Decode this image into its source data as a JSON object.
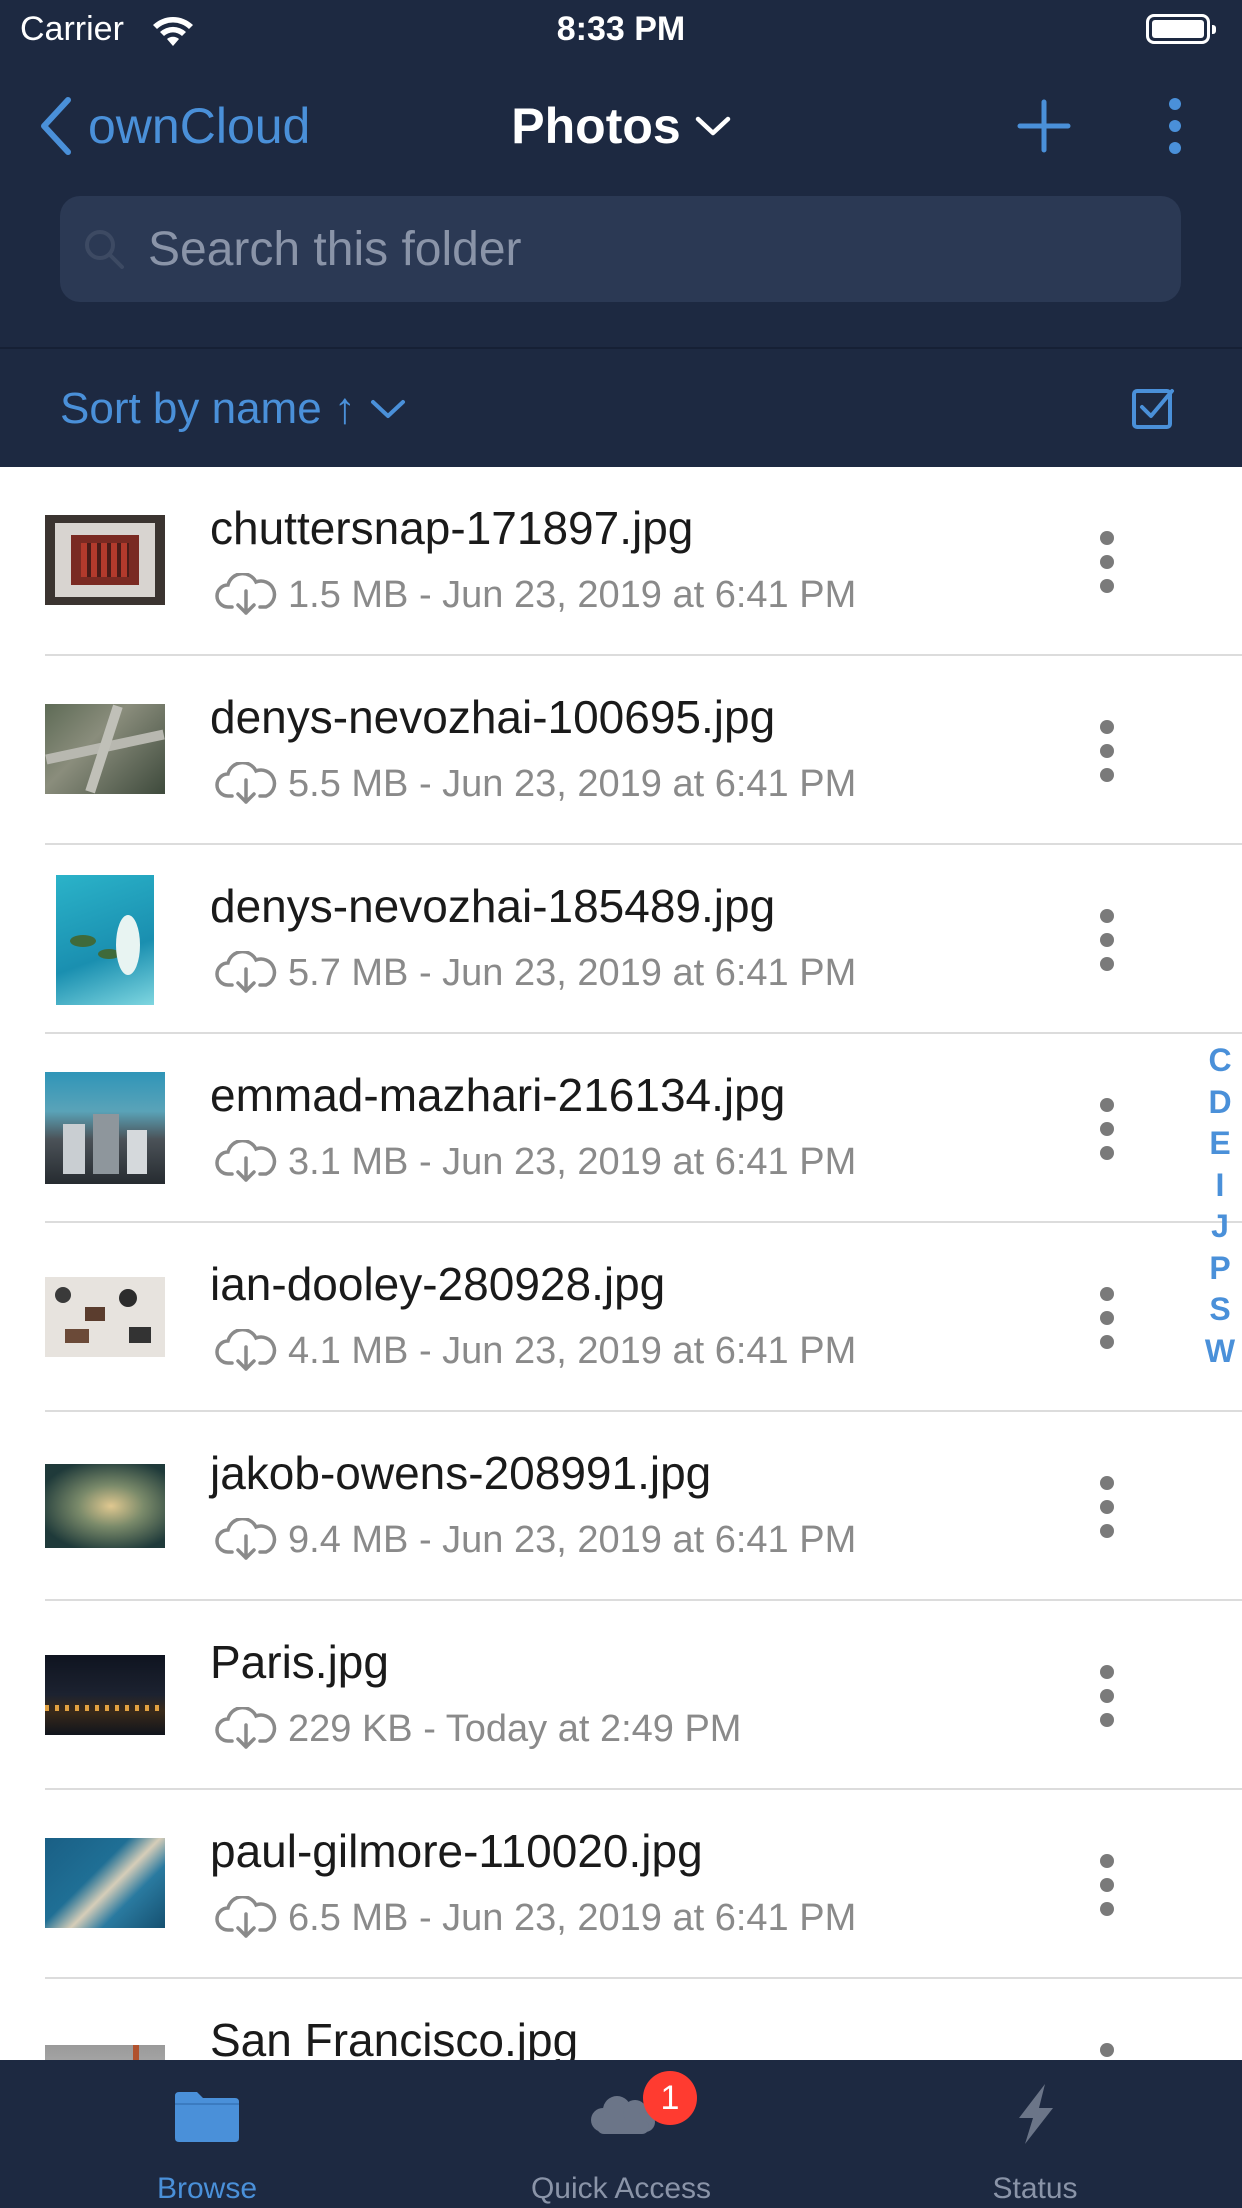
{
  "status_bar": {
    "carrier": "Carrier",
    "time": "8:33 PM"
  },
  "nav": {
    "back_label": "ownCloud",
    "title": "Photos"
  },
  "search": {
    "placeholder": "Search this folder"
  },
  "sort": {
    "label": "Sort by name ↑"
  },
  "files": [
    {
      "name": "chuttersnap-171897.jpg",
      "meta": "1.5 MB - Jun 23, 2019 at 6:41 PM"
    },
    {
      "name": "denys-nevozhai-100695.jpg",
      "meta": "5.5 MB - Jun 23, 2019 at 6:41 PM"
    },
    {
      "name": "denys-nevozhai-185489.jpg",
      "meta": "5.7 MB - Jun 23, 2019 at 6:41 PM"
    },
    {
      "name": "emmad-mazhari-216134.jpg",
      "meta": "3.1 MB - Jun 23, 2019 at 6:41 PM"
    },
    {
      "name": "ian-dooley-280928.jpg",
      "meta": "4.1 MB - Jun 23, 2019 at 6:41 PM"
    },
    {
      "name": "jakob-owens-208991.jpg",
      "meta": "9.4 MB - Jun 23, 2019 at 6:41 PM"
    },
    {
      "name": "Paris.jpg",
      "meta": "229 KB - Today at 2:49 PM"
    },
    {
      "name": "paul-gilmore-110020.jpg",
      "meta": "6.5 MB - Jun 23, 2019 at 6:41 PM"
    },
    {
      "name": "San Francisco.jpg",
      "meta": ""
    }
  ],
  "section_index": [
    "C",
    "D",
    "E",
    "I",
    "J",
    "P",
    "S",
    "W"
  ],
  "tabs": [
    {
      "label": "Browse",
      "icon": "folder-icon",
      "active": true
    },
    {
      "label": "Quick Access",
      "icon": "cloud-icon",
      "active": false,
      "badge": "1"
    },
    {
      "label": "Status",
      "icon": "bolt-icon",
      "active": false
    }
  ],
  "colors": {
    "header_bg": "#1d2941",
    "accent": "#4a90d9",
    "badge": "#ff3b30"
  }
}
